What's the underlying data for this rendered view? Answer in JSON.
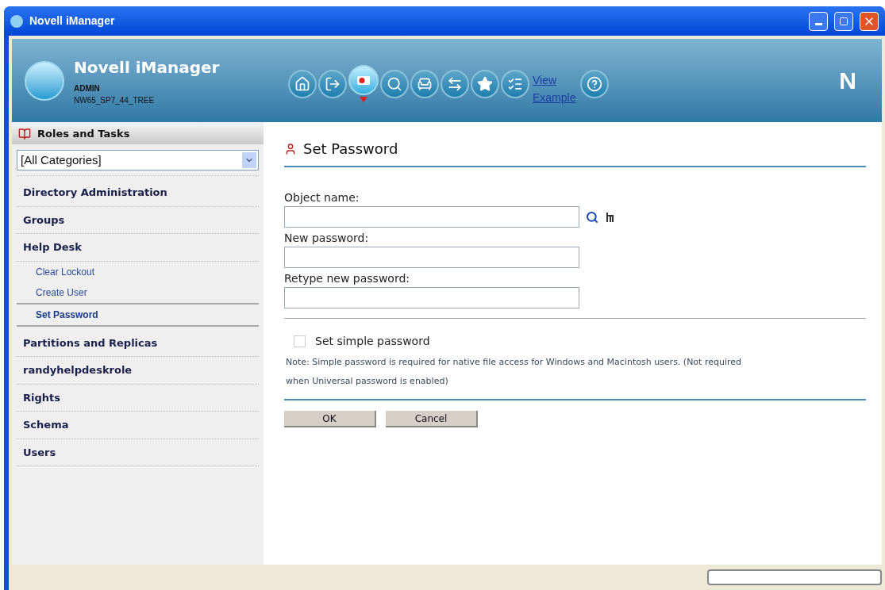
{
  "window": {
    "title": "Novell iManager"
  },
  "header": {
    "product": "Novell iManager",
    "user": "ADMIN",
    "tree": "NW65_SP7_44_TREE",
    "logo_letter": "N",
    "toolbar": [
      {
        "kind": "home",
        "selected": false
      },
      {
        "kind": "exit",
        "selected": false
      },
      {
        "kind": "roles",
        "selected": true
      },
      {
        "kind": "view",
        "selected": false
      },
      {
        "kind": "desk",
        "selected": false
      },
      {
        "kind": "swap",
        "selected": false
      },
      {
        "kind": "favorite",
        "selected": false
      },
      {
        "kind": "check",
        "selected": false
      }
    ],
    "link_line_1": "View",
    "link_line_2": "Example"
  },
  "sidebar": {
    "title": "Roles and Tasks",
    "category_select": "[All Categories]",
    "items": [
      {
        "label": "Directory Administration"
      },
      {
        "label": "Groups"
      },
      {
        "label": "Help Desk",
        "children": [
          {
            "label": "Clear Lockout",
            "selected": false
          },
          {
            "label": "Create User",
            "selected": false
          },
          {
            "label": "Set Password",
            "selected": true
          }
        ]
      },
      {
        "label": "Partitions and Replicas"
      },
      {
        "label": "randyhelpdeskrole"
      },
      {
        "label": "Rights"
      },
      {
        "label": "Schema"
      },
      {
        "label": "Users"
      }
    ]
  },
  "content": {
    "title": "Set Password",
    "fields": [
      {
        "label": "Object name:",
        "browse": true
      },
      {
        "label": "New password:",
        "browse": false
      },
      {
        "label": "Retype new password:",
        "browse": false
      }
    ],
    "checkbox": {
      "label": "Set simple password",
      "checked": false
    },
    "note": "Note: Simple password is required for native file access for Windows and Macintosh users. (Not required when Universal password is enabled)",
    "buttons": [
      "OK",
      "Cancel"
    ]
  },
  "status_bar": {
    "progress": {
      "level": 0
    }
  }
}
